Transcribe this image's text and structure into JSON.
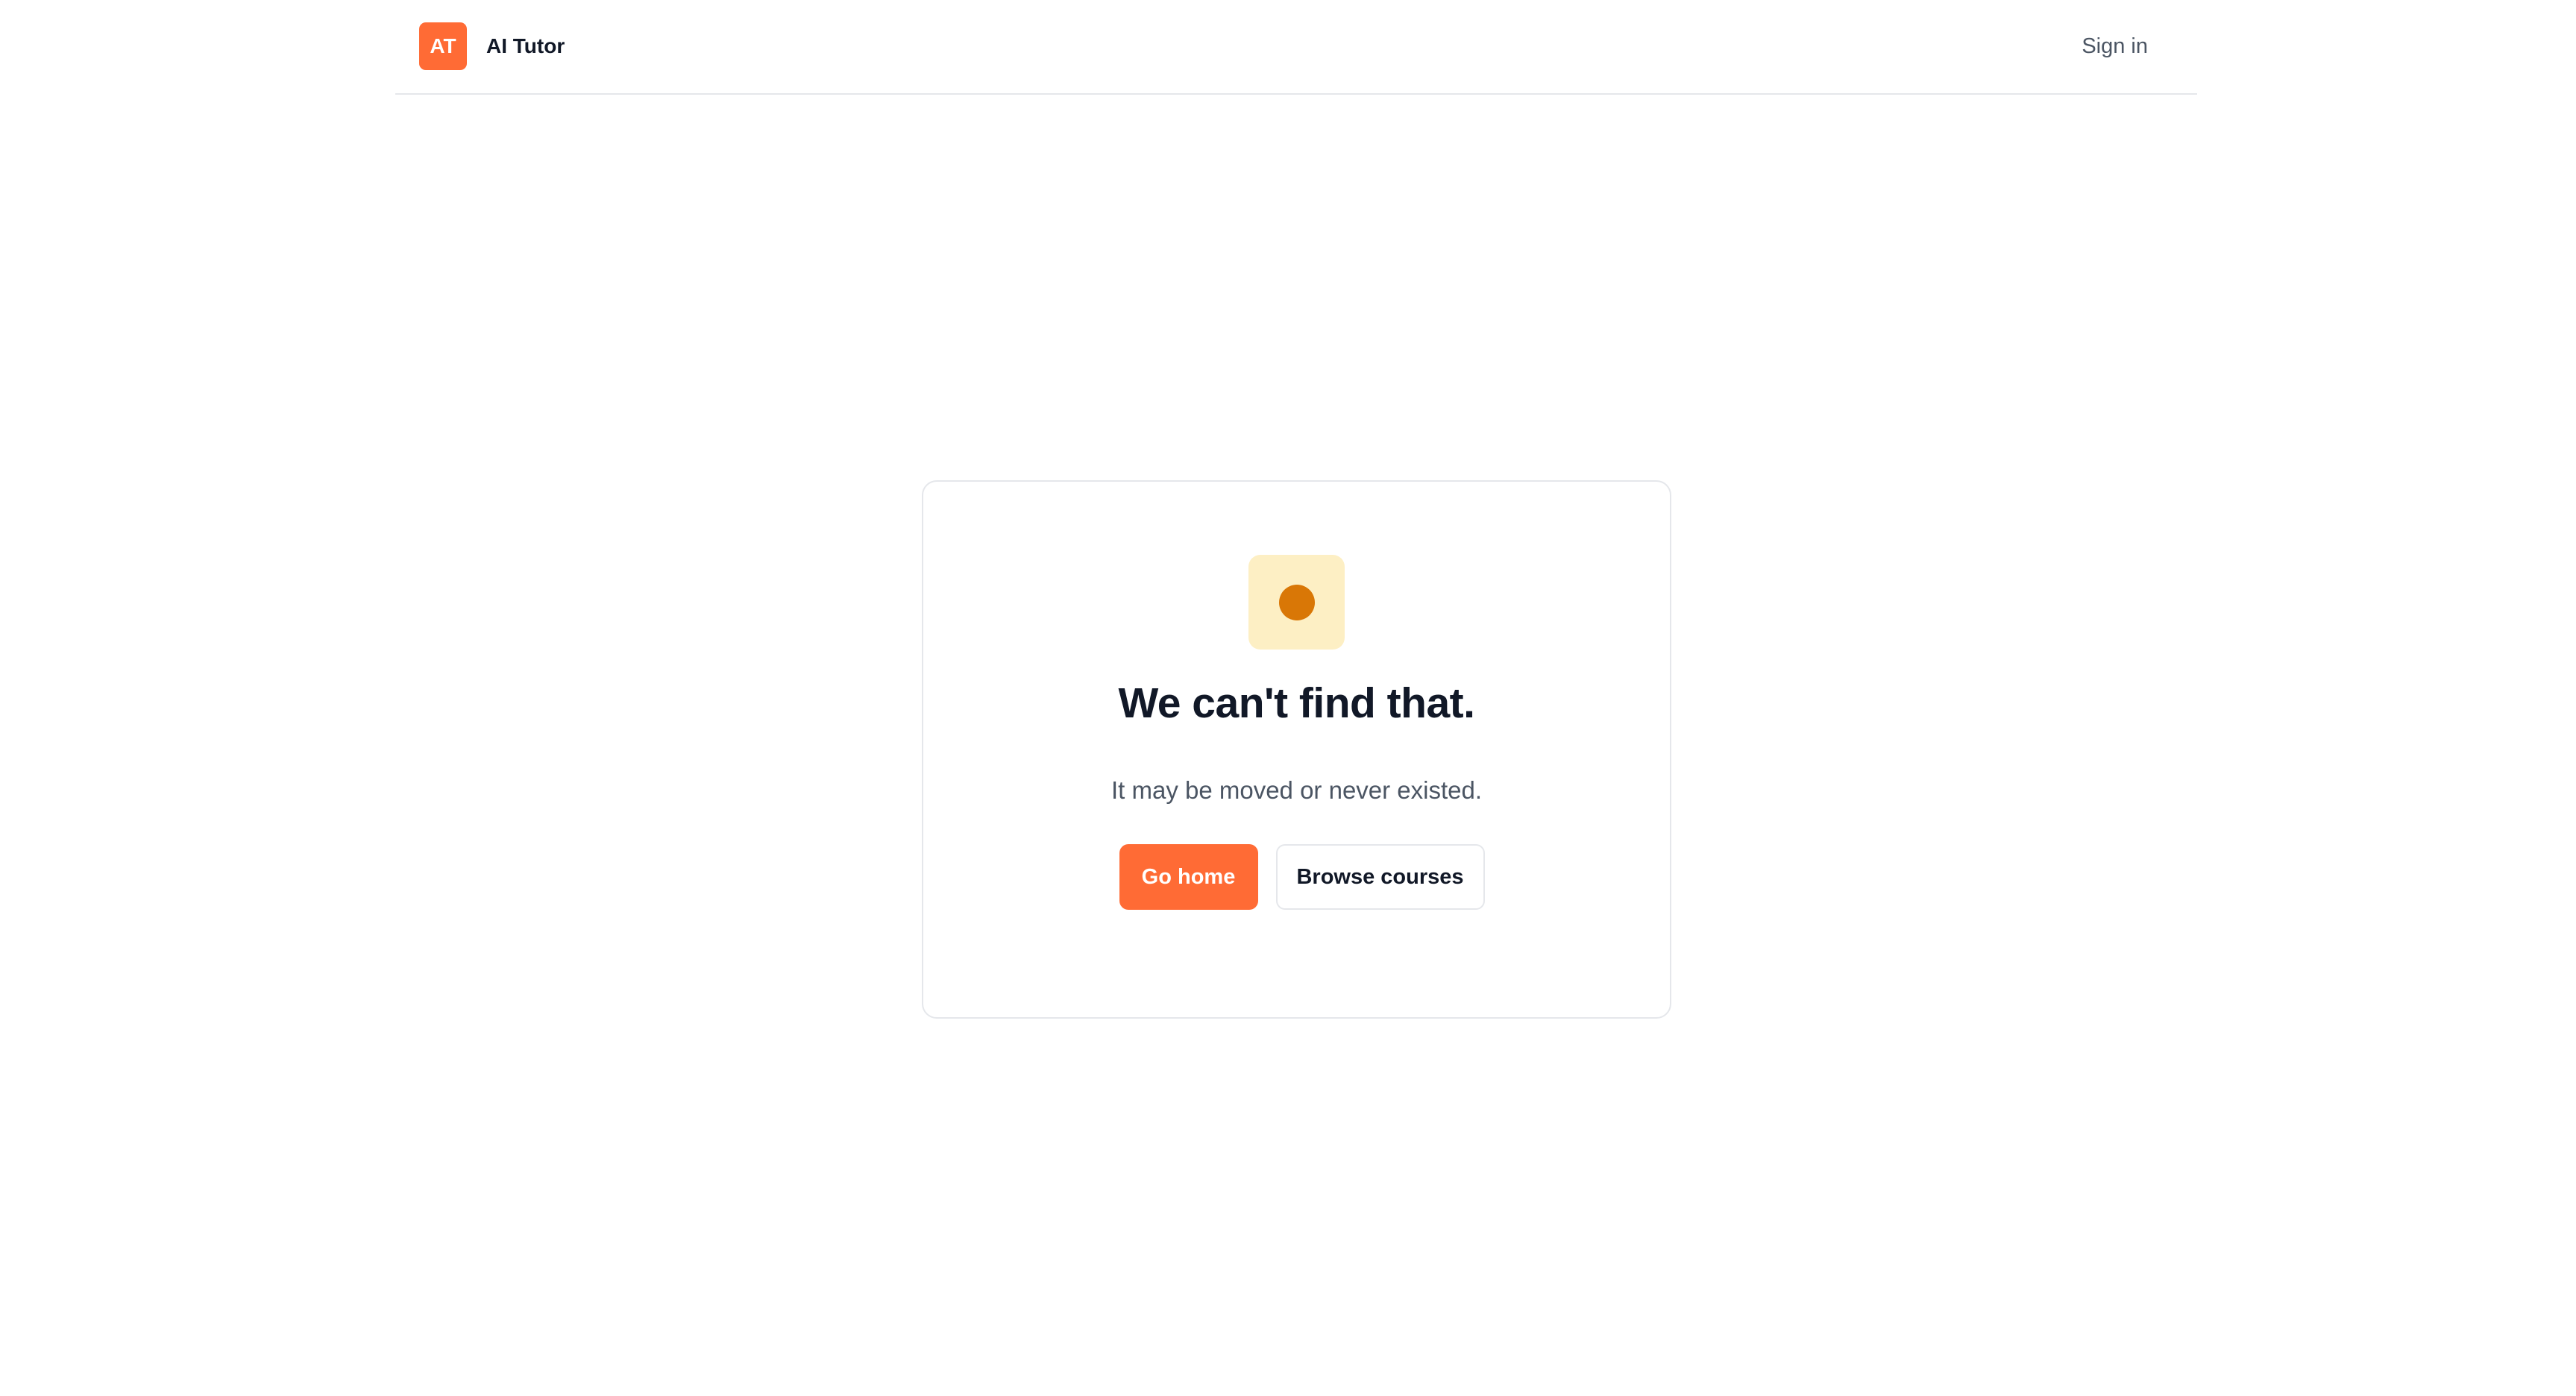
{
  "header": {
    "logo_text": "AT",
    "app_name": "AI Tutor",
    "sign_in_label": "Sign in"
  },
  "error_card": {
    "icon": "alert-dot-icon",
    "title": "We can't find that.",
    "message": "It may be moved or never existed.",
    "primary_button_label": "Go home",
    "secondary_button_label": "Browse courses"
  },
  "colors": {
    "accent": "#ff6b35",
    "icon_tile_bg": "#fdefc4",
    "icon_dot": "#d97706",
    "text_primary": "#111827",
    "text_secondary": "#4b5563",
    "border": "#e5e7eb"
  }
}
